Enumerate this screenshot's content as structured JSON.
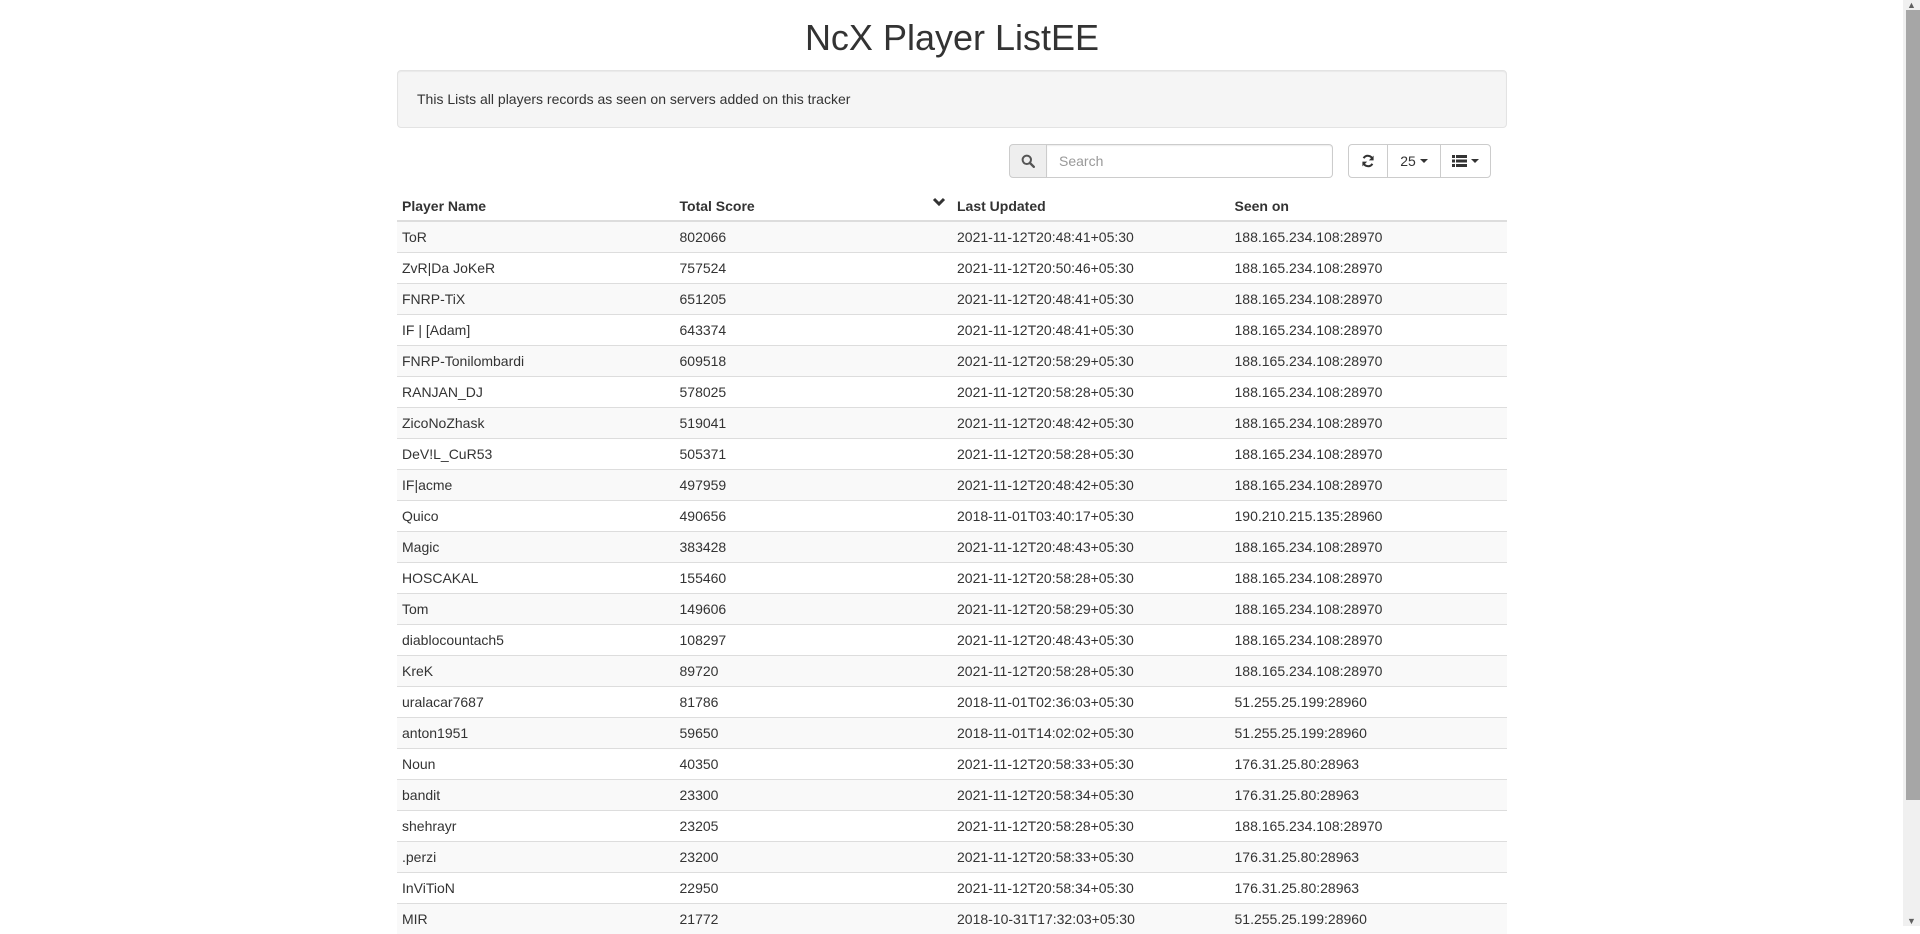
{
  "page": {
    "title": "NcX Player ListEE",
    "description": "This Lists all players records as seen on servers added on this tracker"
  },
  "toolbar": {
    "search_icon": "search-icon",
    "search_placeholder": "Search",
    "search_value": "",
    "refresh_icon": "refresh-icon",
    "page_size": "25",
    "columns_icon": "columns-list-icon"
  },
  "table": {
    "columns": [
      "Player Name",
      "Total Score",
      "Last Updated",
      "Seen on"
    ],
    "sort": {
      "column": "Total Score",
      "direction": "desc",
      "icon": "chevron-down-icon"
    },
    "rows": [
      {
        "name": "ToR",
        "score": "802066",
        "updated": "2021-11-12T20:48:41+05:30",
        "seen": "188.165.234.108:28970"
      },
      {
        "name": "ZvR|Da JoKeR",
        "score": "757524",
        "updated": "2021-11-12T20:50:46+05:30",
        "seen": "188.165.234.108:28970"
      },
      {
        "name": "FNRP-TiX",
        "score": "651205",
        "updated": "2021-11-12T20:48:41+05:30",
        "seen": "188.165.234.108:28970"
      },
      {
        "name": "IF | [Adam]",
        "score": "643374",
        "updated": "2021-11-12T20:48:41+05:30",
        "seen": "188.165.234.108:28970"
      },
      {
        "name": "FNRP-Tonilombardi",
        "score": "609518",
        "updated": "2021-11-12T20:58:29+05:30",
        "seen": "188.165.234.108:28970"
      },
      {
        "name": "RANJAN_DJ",
        "score": "578025",
        "updated": "2021-11-12T20:58:28+05:30",
        "seen": "188.165.234.108:28970"
      },
      {
        "name": "ZicoNoZhask",
        "score": "519041",
        "updated": "2021-11-12T20:48:42+05:30",
        "seen": "188.165.234.108:28970"
      },
      {
        "name": "DeV!L_CuR53",
        "score": "505371",
        "updated": "2021-11-12T20:58:28+05:30",
        "seen": "188.165.234.108:28970"
      },
      {
        "name": "IF|acme",
        "score": "497959",
        "updated": "2021-11-12T20:48:42+05:30",
        "seen": "188.165.234.108:28970"
      },
      {
        "name": "Quico",
        "score": "490656",
        "updated": "2018-11-01T03:40:17+05:30",
        "seen": "190.210.215.135:28960"
      },
      {
        "name": "Magic",
        "score": "383428",
        "updated": "2021-11-12T20:48:43+05:30",
        "seen": "188.165.234.108:28970"
      },
      {
        "name": "HOSCAKAL",
        "score": "155460",
        "updated": "2021-11-12T20:58:28+05:30",
        "seen": "188.165.234.108:28970"
      },
      {
        "name": "Tom",
        "score": "149606",
        "updated": "2021-11-12T20:58:29+05:30",
        "seen": "188.165.234.108:28970"
      },
      {
        "name": "diablocountach5",
        "score": "108297",
        "updated": "2021-11-12T20:48:43+05:30",
        "seen": "188.165.234.108:28970"
      },
      {
        "name": "KreK",
        "score": "89720",
        "updated": "2021-11-12T20:58:28+05:30",
        "seen": "188.165.234.108:28970"
      },
      {
        "name": "uralacar7687",
        "score": "81786",
        "updated": "2018-11-01T02:36:03+05:30",
        "seen": "51.255.25.199:28960"
      },
      {
        "name": "anton1951",
        "score": "59650",
        "updated": "2018-11-01T14:02:02+05:30",
        "seen": "51.255.25.199:28960"
      },
      {
        "name": "Noun",
        "score": "40350",
        "updated": "2021-11-12T20:58:33+05:30",
        "seen": "176.31.25.80:28963"
      },
      {
        "name": "bandit",
        "score": "23300",
        "updated": "2021-11-12T20:58:34+05:30",
        "seen": "176.31.25.80:28963"
      },
      {
        "name": "shehrayr",
        "score": "23205",
        "updated": "2021-11-12T20:58:28+05:30",
        "seen": "188.165.234.108:28970"
      },
      {
        "name": ".perzi",
        "score": "23200",
        "updated": "2021-11-12T20:58:33+05:30",
        "seen": "176.31.25.80:28963"
      },
      {
        "name": "InViTioN",
        "score": "22950",
        "updated": "2021-11-12T20:58:34+05:30",
        "seen": "176.31.25.80:28963"
      },
      {
        "name": "MIR",
        "score": "21772",
        "updated": "2018-10-31T17:32:03+05:30",
        "seen": "51.255.25.199:28960"
      }
    ]
  }
}
